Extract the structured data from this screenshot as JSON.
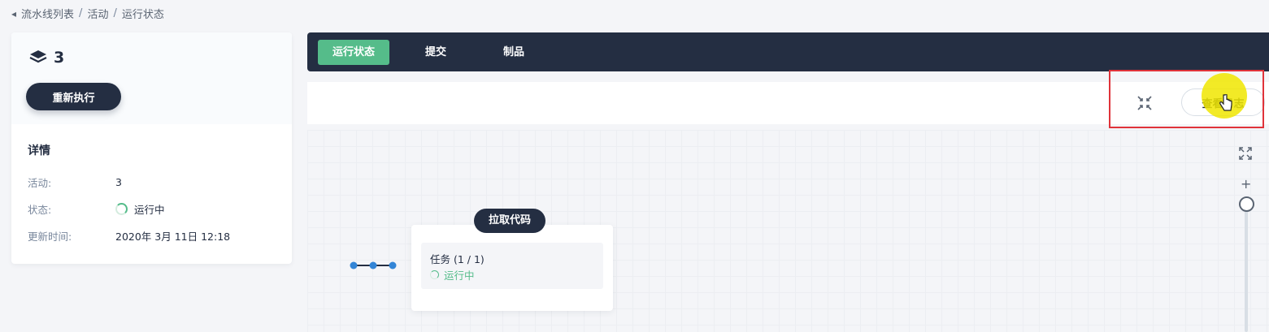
{
  "breadcrumb": {
    "items": [
      "流水线列表",
      "活动",
      "运行状态"
    ],
    "separator": "/"
  },
  "run": {
    "id": "3",
    "rerun_label": "重新执行"
  },
  "details": {
    "title": "详情",
    "rows": [
      {
        "key": "活动:",
        "value": "3"
      },
      {
        "key": "状态:",
        "value": "运行中"
      },
      {
        "key": "更新时间:",
        "value": "2020年 3月 11日 12:18"
      }
    ]
  },
  "tabs": [
    {
      "label": "运行状态",
      "active": true
    },
    {
      "label": "提交",
      "active": false
    },
    {
      "label": "制品",
      "active": false
    }
  ],
  "toolbar": {
    "view_log_label": "查看日志"
  },
  "pipeline": {
    "stage_name": "拉取代码",
    "task_name": "任务 (1 / 1)",
    "task_status": "运行中"
  },
  "zoom": {
    "plus_label": "+",
    "level": 1.0
  },
  "colors": {
    "dark": "#242e42",
    "accent_green": "#55bc8a",
    "highlight_red": "#e0333a",
    "node_blue": "#3385d6"
  }
}
